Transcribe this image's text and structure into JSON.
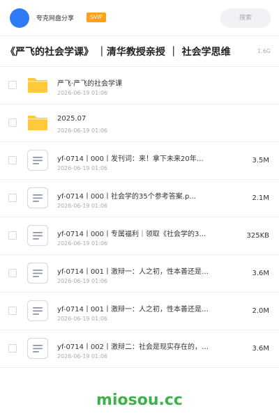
{
  "header": {
    "share_name": "夸克网盘分享",
    "badge": "SVIP",
    "search_placeholder": "搜索"
  },
  "folder": {
    "title": "《严飞的社会学课》 ｜清华教授亲授 ｜ 社会学思维",
    "total_size": "1.6G"
  },
  "files": [
    {
      "type": "folder",
      "name": "严飞·严飞的社会学课",
      "date": "2026-06-19 01:06",
      "size": ""
    },
    {
      "type": "folder",
      "name": "2025.07",
      "date": "2026-06-19 01:06",
      "size": ""
    },
    {
      "type": "doc",
      "name": "yf-0714丨000丨发刊词：来！拿下未来20年…",
      "date": "2026-06-19 01:06",
      "size": "3.5M"
    },
    {
      "type": "doc",
      "name": "yf-0714丨000丨社会学的35个参考答案.p…",
      "date": "2026-06-19 01:06",
      "size": "2.1M"
    },
    {
      "type": "doc",
      "name": "yf-0714丨000丨专属福利｜领取《社会学的3…",
      "date": "2026-06-19 01:06",
      "size": "325KB"
    },
    {
      "type": "doc",
      "name": "yf-0714丨001丨激辩一：人之初，性本善还是…",
      "date": "2026-06-19 01:06",
      "size": "3.6M"
    },
    {
      "type": "doc",
      "name": "yf-0714丨001丨激辩一：人之初，性本善还是…",
      "date": "2026-06-19 01:06",
      "size": "2.0M"
    },
    {
      "type": "doc",
      "name": "yf-0714丨002丨激辩二：社会是现实存在的，…",
      "date": "2026-06-19 01:06",
      "size": "3.6M"
    }
  ],
  "watermark": "miosou.cc",
  "colors": {
    "folder": "#ffc93c",
    "doc_icon": "#8a94a6",
    "accent": "#2f7bf5",
    "watermark": "#3cb34a"
  }
}
